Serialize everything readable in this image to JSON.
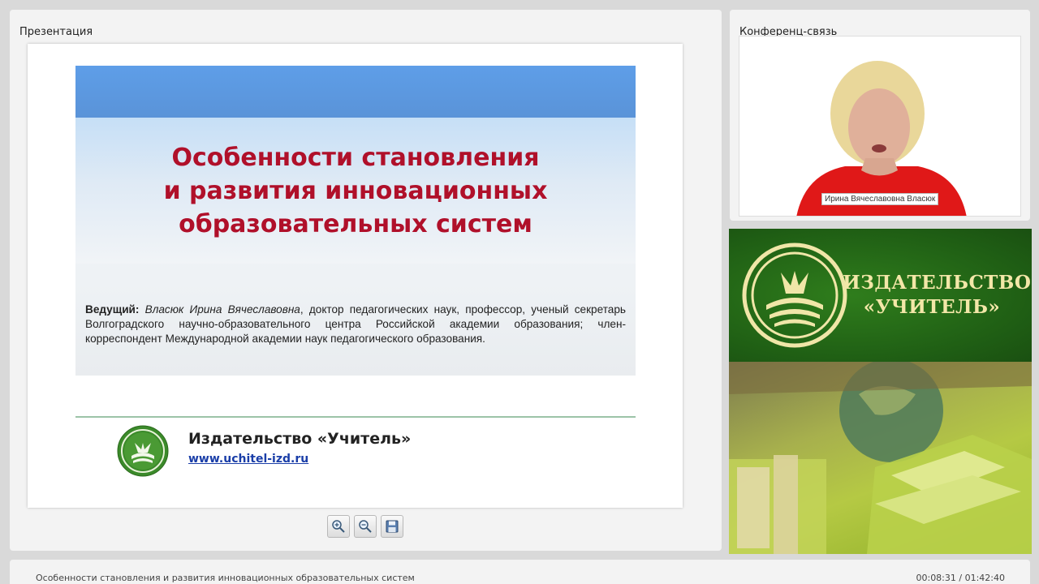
{
  "presentation_panel": {
    "title": "Презентация"
  },
  "slide": {
    "title_lines": [
      "Особенности становления",
      "и развития инновационных",
      "образовательных систем"
    ],
    "host_label": "Ведущий:",
    "host_name": "Власюк Ирина Вячеславовна",
    "host_description": ", доктор педагогических наук, профессор, ученый секретарь Волгоградского научно-образовательного центра Российской академии образования; член-корреспондент Международной академии наук педагогического образования.",
    "publisher": "Издательство «Учитель»",
    "url": "www.uchitel-izd.ru"
  },
  "toolbar": {
    "zoom_in_icon": "zoom-in-icon",
    "zoom_out_icon": "zoom-out-icon",
    "save_icon": "save-icon"
  },
  "conference_panel": {
    "title": "Конференц-связь",
    "speaker_name": "Ирина Вячеславовна Власюк"
  },
  "ad_banner": {
    "text_lines": [
      "ИЗДАТЕЛЬСТВО",
      "«УЧИТЕЛЬ»"
    ]
  },
  "status_bar": {
    "title": "Особенности становления и развития инновационных образовательных систем",
    "time": "00:08:31 / 01:42:40"
  },
  "colors": {
    "title_red": "#b0102a",
    "logo_green": "#2f7d1c",
    "banner_gold": "#f3e7a8"
  }
}
